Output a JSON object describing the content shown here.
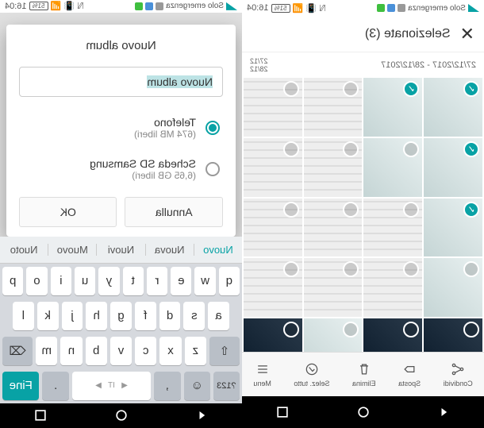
{
  "status": {
    "carrier": "Solo emergenza",
    "battery": "51%",
    "time": "16:04"
  },
  "dialog": {
    "title": "Nuovo album",
    "input_value": "Nuovo album",
    "option1": {
      "label": "Telefono",
      "sub": "(674 MB liberi)"
    },
    "option2": {
      "label": "Scheda SD Samsung",
      "sub": "(6,65 GB liberi)"
    },
    "cancel": "Annulla",
    "ok": "OK"
  },
  "keyboard": {
    "suggestions": [
      "Nuovo",
      "Nuova",
      "Nuovi",
      "Muovo",
      "Nuoto"
    ],
    "row1": [
      "q",
      "w",
      "e",
      "r",
      "t",
      "y",
      "u",
      "i",
      "o",
      "p"
    ],
    "row2": [
      "a",
      "s",
      "d",
      "f",
      "g",
      "h",
      "j",
      "k",
      "l"
    ],
    "row3_mid": [
      "z",
      "x",
      "c",
      "v",
      "b",
      "n",
      "m"
    ],
    "done": "Fine",
    "symbols": "?123",
    "lang": "IT"
  },
  "gallery": {
    "header": "Selezionate (3)",
    "date_range": "27/12/2017 - 28/12/2017",
    "date_right": "27/12\n28/12",
    "toolbar": {
      "share": "Condividi",
      "move": "Sposta",
      "delete": "Elimina",
      "select_all": "Selez. tutto",
      "menu": "Menu"
    }
  }
}
